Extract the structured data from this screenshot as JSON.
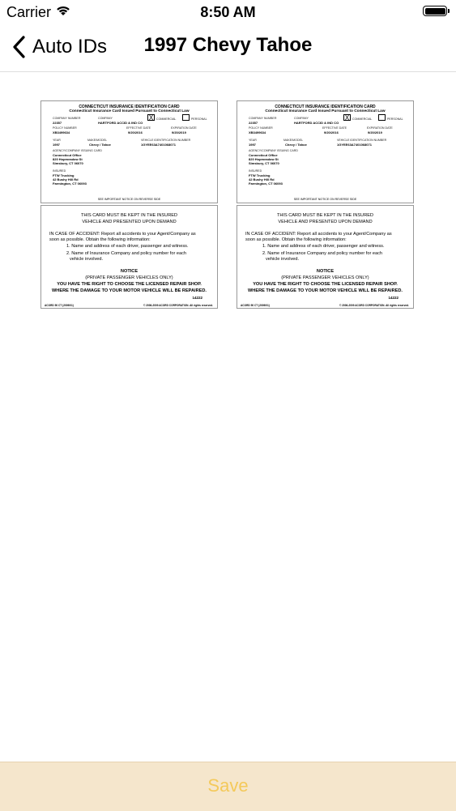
{
  "status_bar": {
    "carrier": "Carrier",
    "time": "8:50 AM"
  },
  "nav": {
    "back_label": "Auto IDs",
    "title": "1997 Chevy Tahoe"
  },
  "cards": [
    {
      "front": {
        "title": "CONNECTICUT INSURANCE IDENTIFICATION CARD",
        "subtitle": "Connecticut Insurance Card Issued Pursuant to Connecticut Law",
        "company_number_label": "COMPANY NUMBER",
        "company_number": "22357",
        "company_label": "COMPANY",
        "company": "HARTFORD ACCID & IND CO",
        "commercial_label": "COMMERCIAL",
        "commercial_mark": "X",
        "personal_label": "PERSONAL",
        "policy_number_label": "POLICY NUMBER",
        "policy_number": "XB3499634",
        "effective_date_label": "EFFECTIVE DATE",
        "effective_date": "9/20/2016",
        "expiration_date_label": "EXPIRATION DATE",
        "expiration_date": "9/20/2019",
        "year_label": "YEAR",
        "year": "1997",
        "make_model_label": "MAKE/MODEL",
        "make_model": "Chevy / Tahoe",
        "vin_label": "VEHICLE IDENTIFICATION NUMBER",
        "vin": "1GYEE63A7401068071",
        "agency_label": "AGENCY/COMPANY ISSUING CARD",
        "agency_1": "Connecticut Office",
        "agency_2": "820 Hopmeadow St",
        "agency_3": "Simsbury, CT 06070",
        "insured_label": "INSURED",
        "insured_1": "FTW Trucking",
        "insured_2": "42 Bushy Hill Rd",
        "insured_3": "Farmington, CT 06093",
        "footer": "SEE IMPORTANT NOTICE ON REVERSE SIDE"
      },
      "back": {
        "line1": "THIS CARD MUST BE KEPT IN THE INSURED",
        "line2": "VEHICLE AND PRESENTED UPON DEMAND",
        "accident1": "IN CASE OF ACCIDENT:  Report all accidents to your Agent/Company as",
        "accident2": "soon as possible. Obtain the following information:",
        "item1": "1. Name and address of each driver, passenger and witness.",
        "item2a": "2. Name of Insurance Company and policy number for each",
        "item2b": "vehicle involved.",
        "notice": "NOTICE",
        "private": "(PRIVATE PASSENGER VEHICLES ONLY)",
        "right1": "YOU HAVE THE RIGHT TO CHOOSE THE LICENSED REPAIR SHOP.",
        "right2": "WHERE THE DAMAGE TO YOUR MOTOR VEHICLE WILL BE REPAIRED.",
        "code": "14222",
        "form": "ACORD 50 CT (2009/01)",
        "copyright": "© 2006-2009 ACORD CORPORATION. All rights reserved."
      }
    },
    {
      "front": {
        "title": "CONNECTICUT INSURANCE IDENTIFICATION CARD",
        "subtitle": "Connecticut Insurance Card Issued Pursuant to Connecticut Law",
        "company_number_label": "COMPANY NUMBER",
        "company_number": "22357",
        "company_label": "COMPANY",
        "company": "HARTFORD ACCID & IND CO",
        "commercial_label": "COMMERCIAL",
        "commercial_mark": "X",
        "personal_label": "PERSONAL",
        "policy_number_label": "POLICY NUMBER",
        "policy_number": "XB3499634",
        "effective_date_label": "EFFECTIVE DATE",
        "effective_date": "9/20/2016",
        "expiration_date_label": "EXPIRATION DATE",
        "expiration_date": "9/20/2019",
        "year_label": "YEAR",
        "year": "1997",
        "make_model_label": "MAKE/MODEL",
        "make_model": "Chevy / Tahoe",
        "vin_label": "VEHICLE IDENTIFICATION NUMBER",
        "vin": "1GYEE63A7401068071",
        "agency_label": "AGENCY/COMPANY ISSUING CARD",
        "agency_1": "Connecticut Office",
        "agency_2": "820 Hopmeadow St",
        "agency_3": "Simsbury, CT 06070",
        "insured_label": "INSURED",
        "insured_1": "FTW Trucking",
        "insured_2": "42 Bushy Hill Rd",
        "insured_3": "Farmington, CT 06093",
        "footer": "SEE IMPORTANT NOTICE ON REVERSE SIDE"
      },
      "back": {
        "line1": "THIS CARD MUST BE KEPT IN THE INSURED",
        "line2": "VEHICLE AND PRESENTED UPON DEMAND",
        "accident1": "IN CASE OF ACCIDENT:  Report all accidents to your Agent/Company as",
        "accident2": "soon as possible. Obtain the following information:",
        "item1": "1. Name and address of each driver, passenger and witness.",
        "item2a": "2. Name of Insurance Company and policy number for each",
        "item2b": "vehicle involved.",
        "notice": "NOTICE",
        "private": "(PRIVATE PASSENGER VEHICLES ONLY)",
        "right1": "YOU HAVE THE RIGHT TO CHOOSE THE LICENSED REPAIR SHOP.",
        "right2": "WHERE THE DAMAGE TO YOUR MOTOR VEHICLE WILL BE REPAIRED.",
        "code": "14222",
        "form": "ACORD 50 CT (2009/01)",
        "copyright": "© 2006-2009 ACORD CORPORATION. All rights reserved."
      }
    }
  ],
  "footer": {
    "save_label": "Save"
  },
  "colors": {
    "save_text": "#f4c95a",
    "save_bar": "#f5e6cc"
  },
  "icons": {
    "back": "chevron-left-icon",
    "wifi": "wifi-icon",
    "battery": "battery-icon"
  }
}
